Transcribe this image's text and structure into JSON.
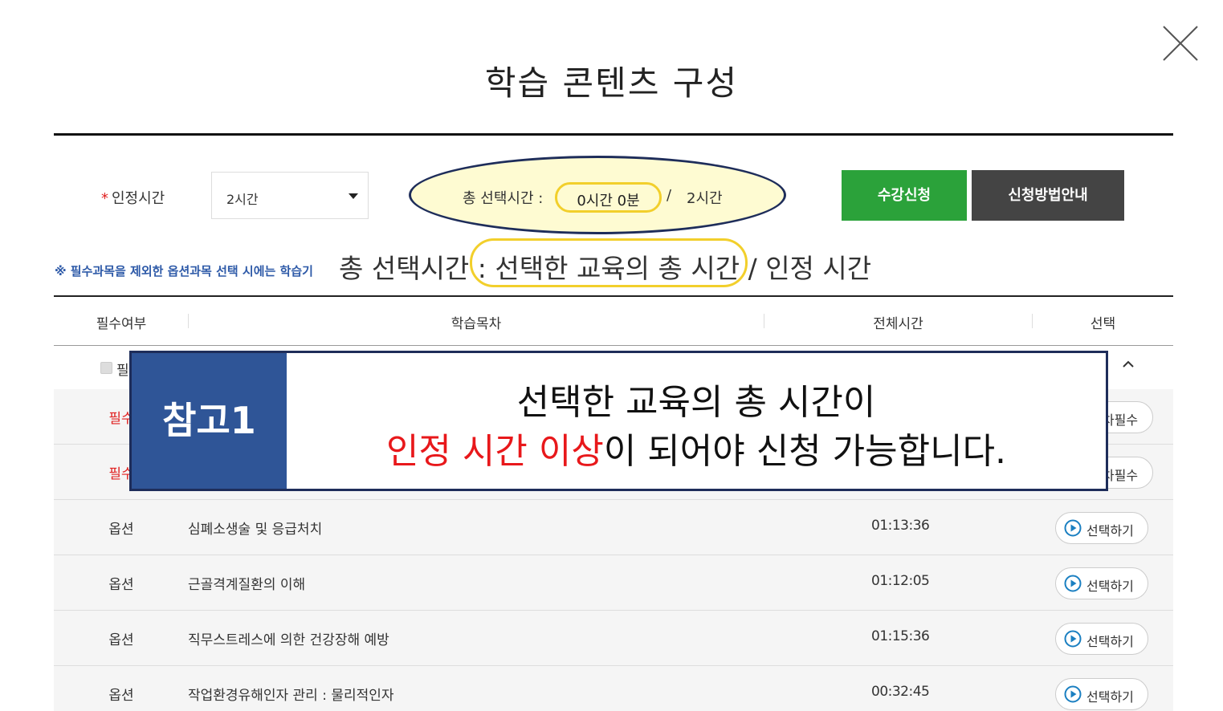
{
  "modal": {
    "title": "학습 콘텐츠 구성",
    "close_icon": "close-icon"
  },
  "controls": {
    "required_mark": "*",
    "time_label": "인정시간",
    "time_select_value": "2시간",
    "selected_time_label": "총 선택시간 :",
    "selected_time_value": "0시간 0분",
    "separator": "/",
    "recognized_time": "2시간",
    "apply_button": "수강신청",
    "guide_button": "신청방법안내"
  },
  "notes": {
    "option_note": "※ 필수과목을 제외한 옵션과목 선택 시에는 학습기",
    "annotation": "총 선택시간 : 선택한 교육의 총 시간 / 인정 시간"
  },
  "table": {
    "headers": [
      "필수여부",
      "학습목차",
      "전체시간",
      "선택"
    ],
    "group_label": "필",
    "required_rows": [
      {
        "type": "필수",
        "button": "차필수"
      },
      {
        "type": "필수",
        "button": "차필수"
      }
    ],
    "option_rows": [
      {
        "type": "옵션",
        "title": "심폐소생술 및 응급처치",
        "time": "01:13:36",
        "button": "선택하기"
      },
      {
        "type": "옵션",
        "title": "근골격계질환의 이해",
        "time": "01:12:05",
        "button": "선택하기"
      },
      {
        "type": "옵션",
        "title": "직무스트레스에 의한 건강장해 예방",
        "time": "01:15:36",
        "button": "선택하기"
      },
      {
        "type": "옵션",
        "title": "작업환경유해인자 관리 : 물리적인자",
        "time": "00:32:45",
        "button": "선택하기"
      }
    ]
  },
  "callout": {
    "tag": "참고1",
    "line1": "선택한 교육의 총 시간이",
    "line2_highlight": "인정 시간 이상",
    "line2_rest": "이 되어야 신청 가능합니다."
  },
  "colors": {
    "green": "#2ba23a",
    "dark": "#444444",
    "navy": "#1e2d5a",
    "blue_tag": "#2f5597",
    "highlight_red": "#e8181b",
    "yellow": "#f2cf2b"
  }
}
